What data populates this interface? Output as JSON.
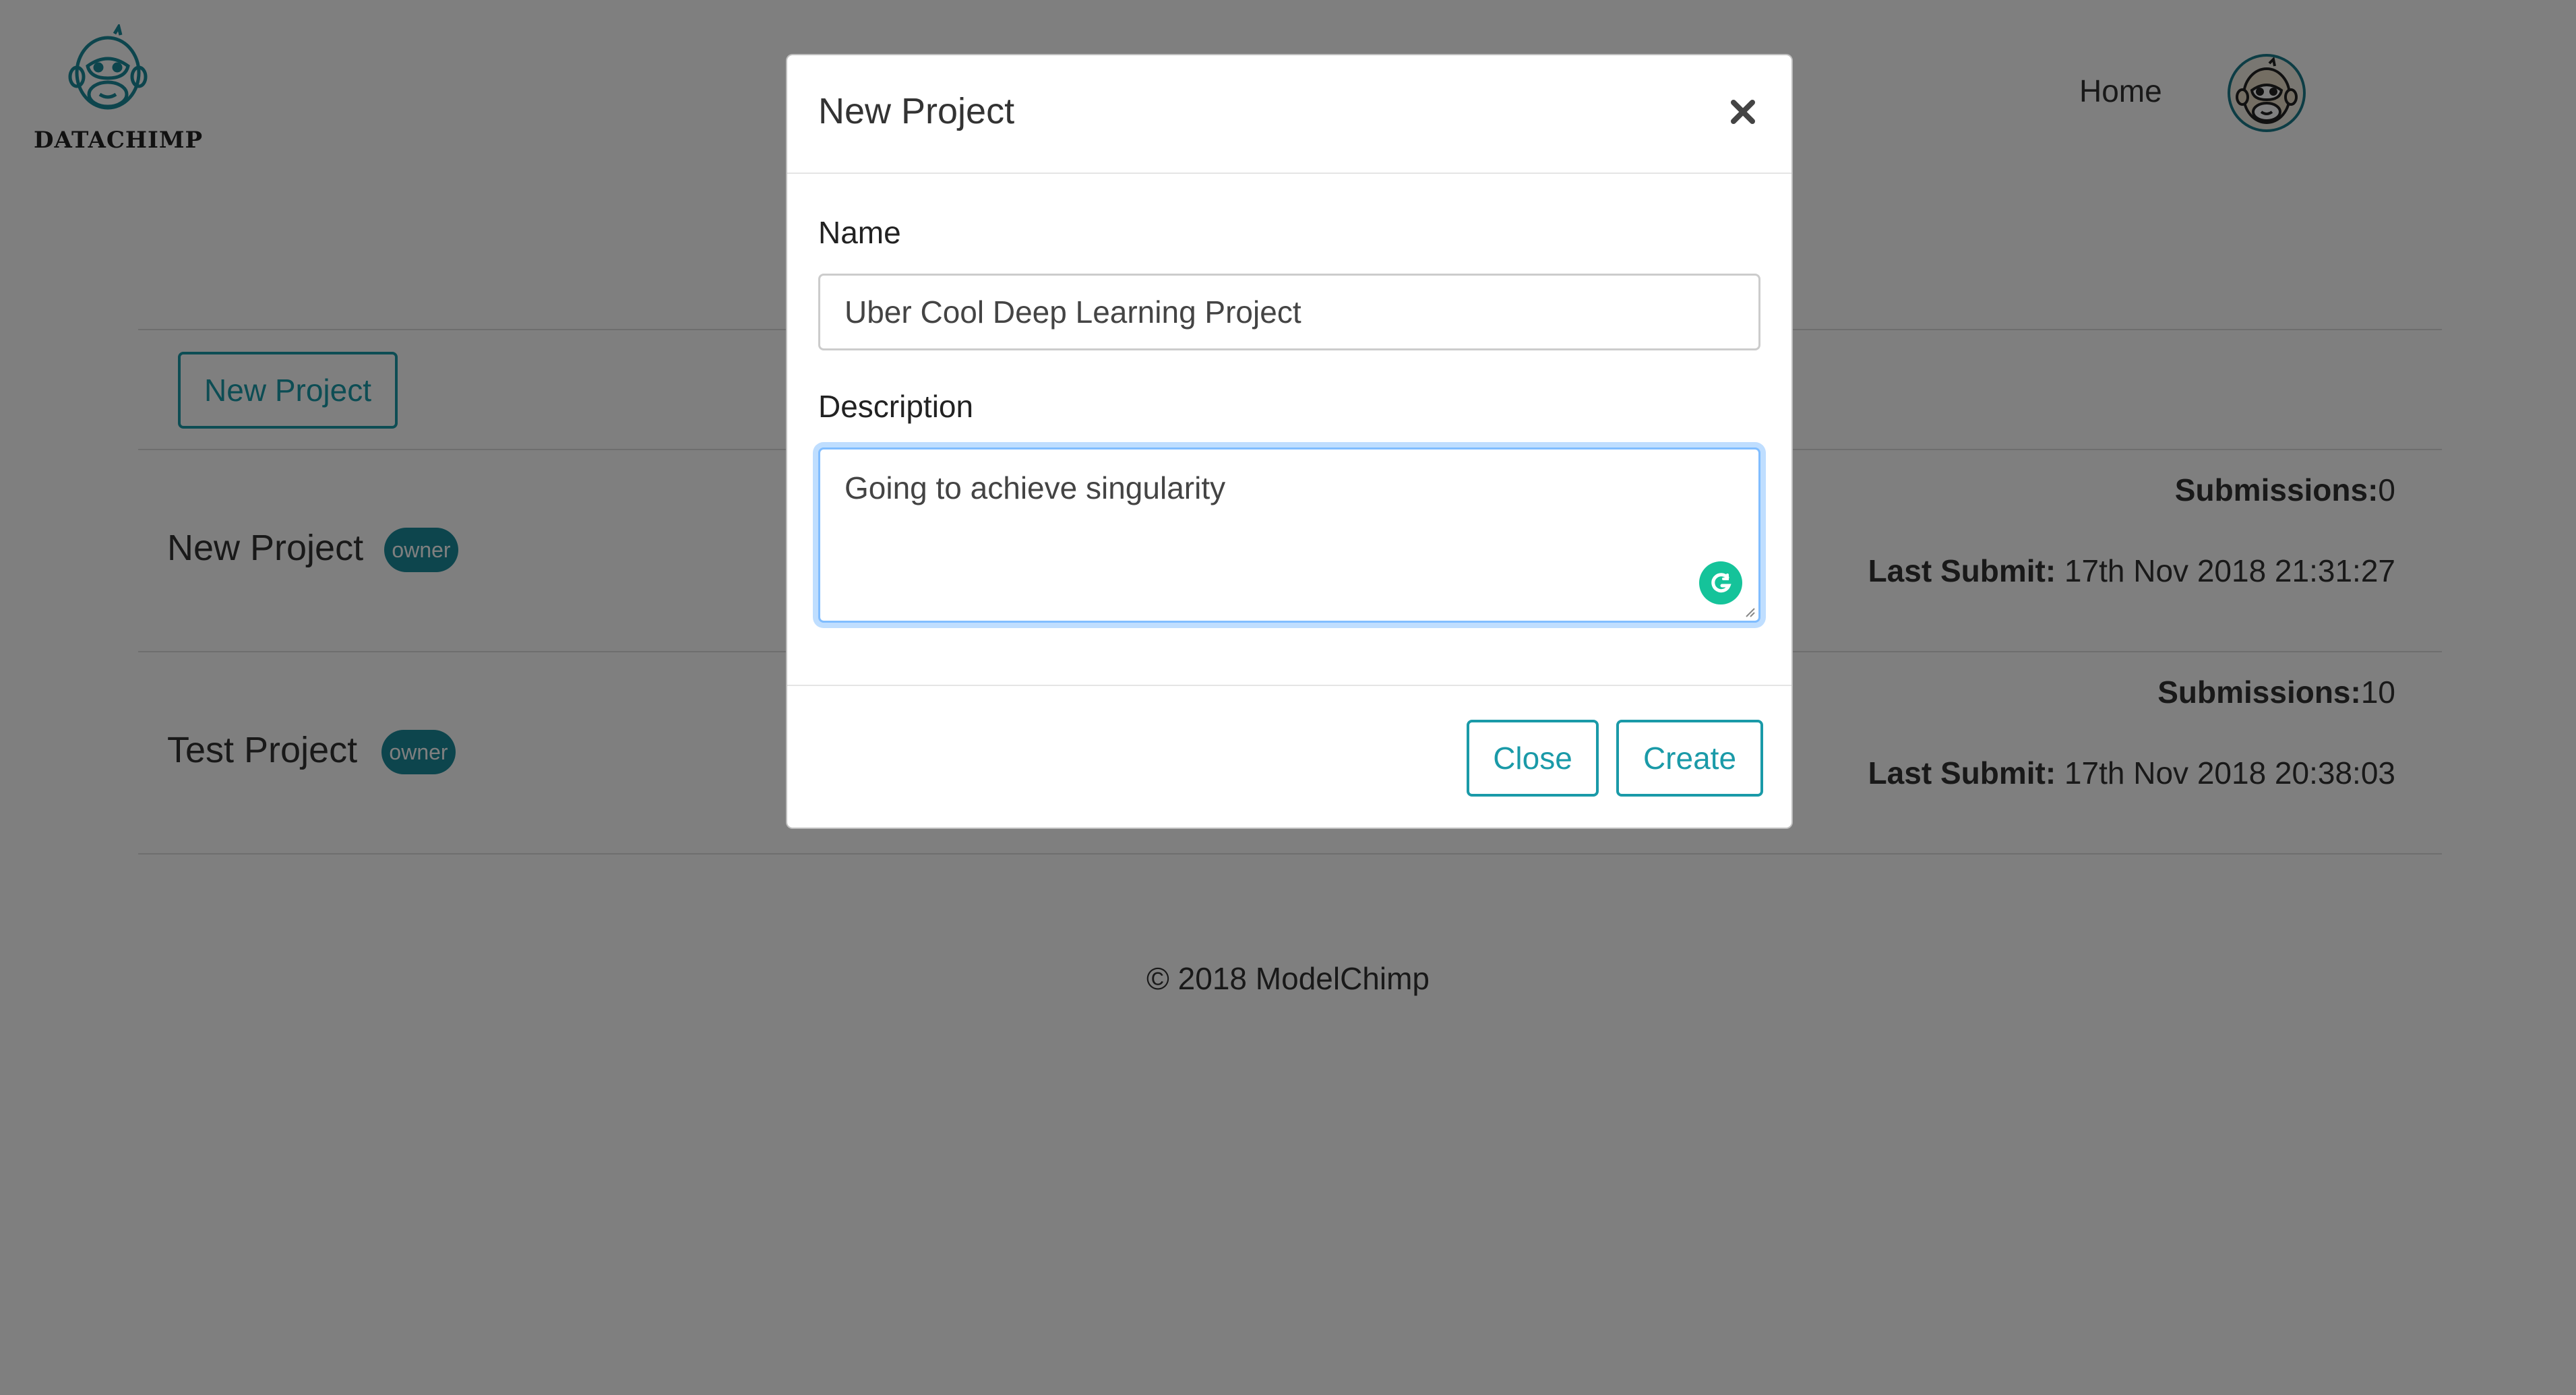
{
  "header": {
    "logo_text": "DATACHIMP",
    "nav_home": "Home"
  },
  "toolbar": {
    "new_project_label": "New Project"
  },
  "projects": [
    {
      "name": "New Project",
      "badge": "owner",
      "submissions_label": "Submissions:",
      "submissions_value": "0",
      "last_submit_label": "Last Submit:",
      "last_submit_value": "17th Nov 2018 21:31:27"
    },
    {
      "name": "Test Project",
      "badge": "owner",
      "submissions_label": "Submissions:",
      "submissions_value": "10",
      "last_submit_label": "Last Submit:",
      "last_submit_value": "17th Nov 2018 20:38:03"
    }
  ],
  "footer": {
    "copyright": "© 2018 ModelChimp"
  },
  "modal": {
    "title": "New Project",
    "name_label": "Name",
    "name_value": "Uber Cool Deep Learning Project",
    "description_label": "Description",
    "description_value": "Going to achieve singularity",
    "close_label": "Close",
    "create_label": "Create"
  },
  "colors": {
    "accent": "#1a9aa8",
    "badge": "#1a8a9a",
    "grammarly": "#15c39a",
    "focus_border": "#80bdff"
  },
  "icons": [
    "chimp-logo-icon",
    "avatar-chimp-icon",
    "close-icon",
    "grammarly-icon"
  ]
}
